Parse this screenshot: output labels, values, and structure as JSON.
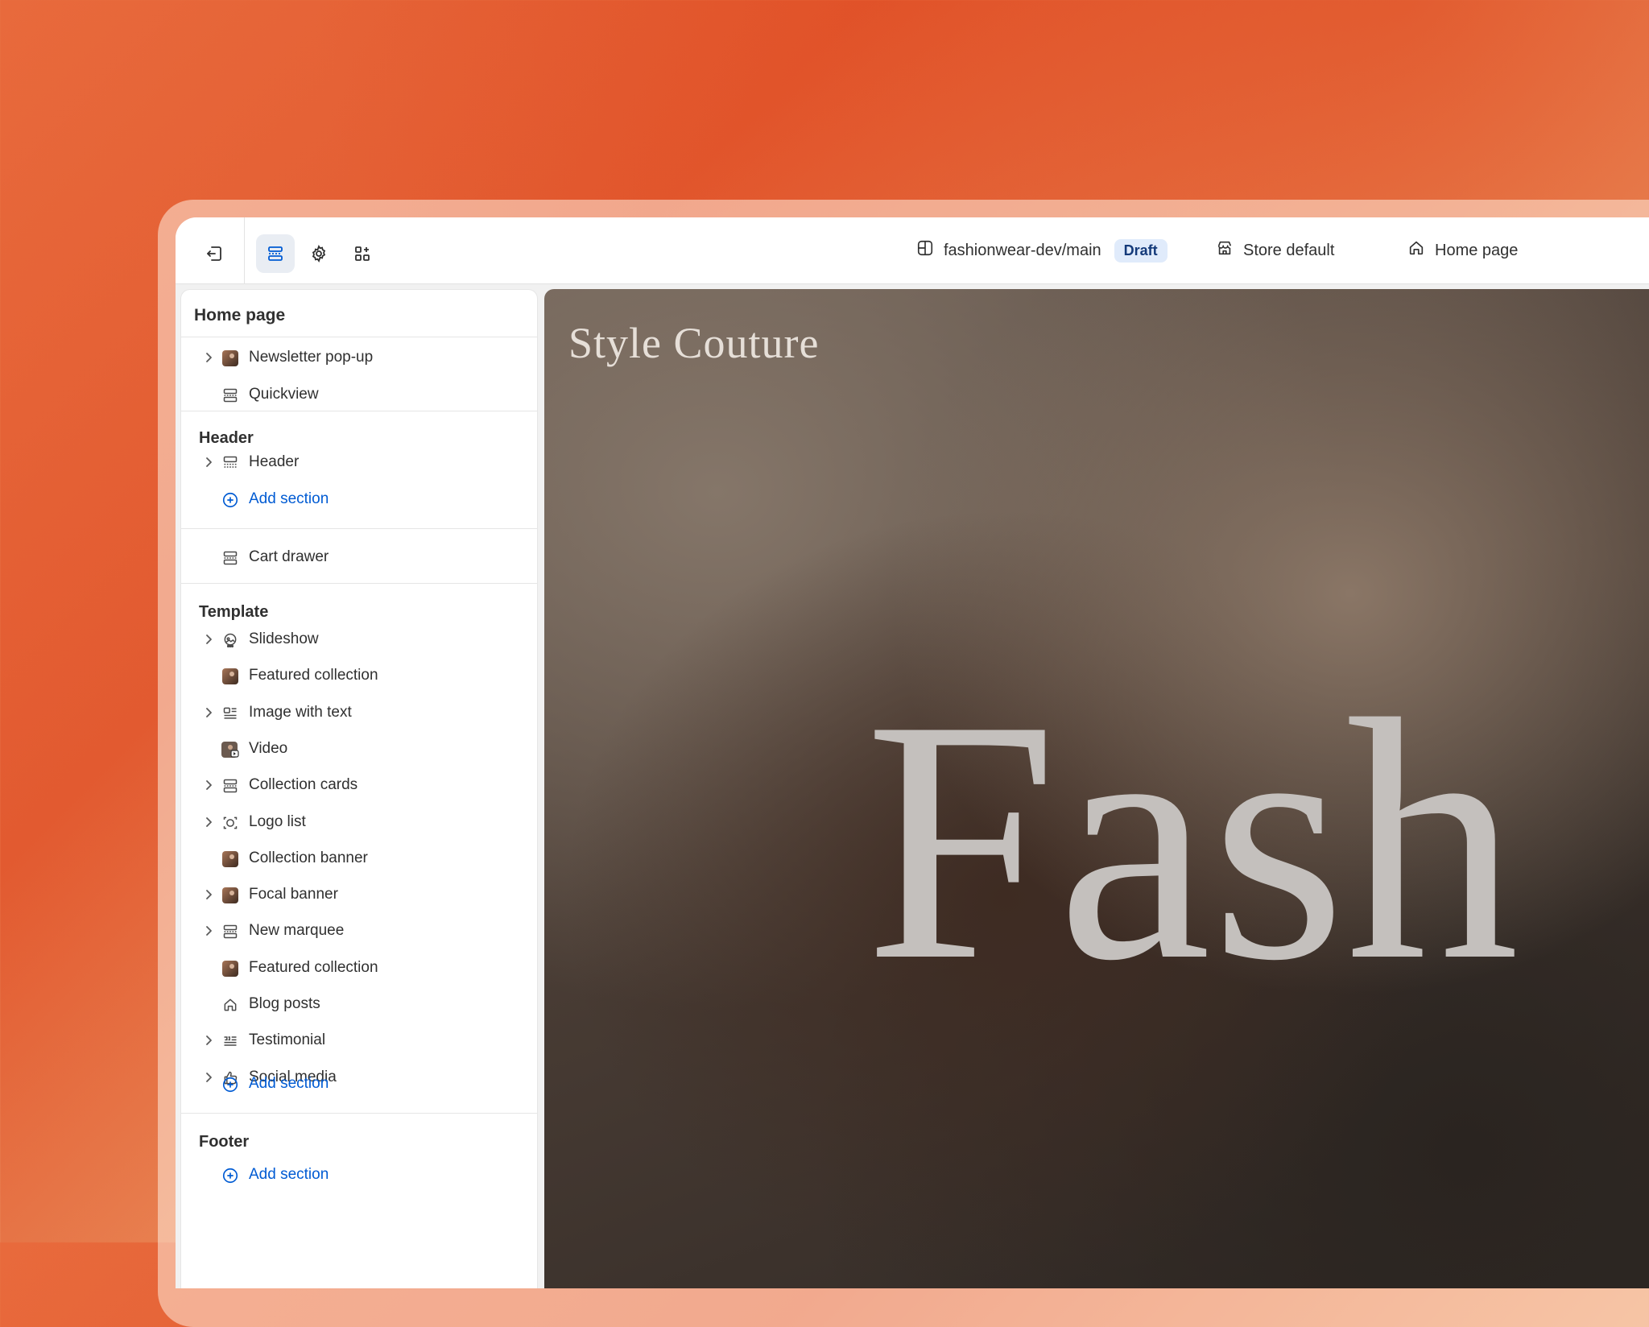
{
  "topbar": {
    "branch": "fashionwear-dev/main",
    "status_badge": "Draft",
    "store": "Store default",
    "page_select": "Home page"
  },
  "sidebar": {
    "title": "Home page",
    "top_items": [
      {
        "label": "Newsletter pop-up",
        "expandable": true,
        "icon": "image-thumb-icon"
      },
      {
        "label": "Quickview",
        "expandable": false,
        "icon": "section-icon"
      }
    ],
    "header_group": {
      "title": "Header",
      "items": [
        {
          "label": "Header",
          "expandable": true,
          "icon": "header-section-icon"
        }
      ],
      "add_label": "Add section"
    },
    "cart_drawer": {
      "label": "Cart drawer",
      "icon": "section-icon"
    },
    "template_group": {
      "title": "Template",
      "items": [
        {
          "label": "Slideshow",
          "expandable": true,
          "icon": "slideshow-icon"
        },
        {
          "label": "Featured collection",
          "expandable": false,
          "icon": "image-thumb-icon"
        },
        {
          "label": "Image with text",
          "expandable": true,
          "icon": "image-with-text-icon"
        },
        {
          "label": "Video",
          "expandable": false,
          "icon": "video-thumb-icon"
        },
        {
          "label": "Collection cards",
          "expandable": true,
          "icon": "section-icon"
        },
        {
          "label": "Logo list",
          "expandable": true,
          "icon": "logo-list-icon"
        },
        {
          "label": "Collection banner",
          "expandable": false,
          "icon": "image-thumb-icon"
        },
        {
          "label": "Focal banner",
          "expandable": true,
          "icon": "image-thumb-icon"
        },
        {
          "label": "New marquee",
          "expandable": true,
          "icon": "section-icon"
        },
        {
          "label": "Featured collection",
          "expandable": false,
          "icon": "image-thumb-icon"
        },
        {
          "label": "Blog posts",
          "expandable": false,
          "icon": "home-icon"
        },
        {
          "label": "Testimonial",
          "expandable": true,
          "icon": "testimonial-icon"
        },
        {
          "label": "Social media",
          "expandable": true,
          "icon": "thumbs-up-icon"
        }
      ],
      "add_label": "Add section"
    },
    "footer_group": {
      "title": "Footer",
      "add_label": "Add section"
    }
  },
  "preview": {
    "brand": "Style Couture",
    "hero_text": "Fash"
  },
  "colors": {
    "accent_blue": "#005bd3",
    "badge_bg": "#e0ebfb",
    "background_orange": "#e25a30"
  }
}
